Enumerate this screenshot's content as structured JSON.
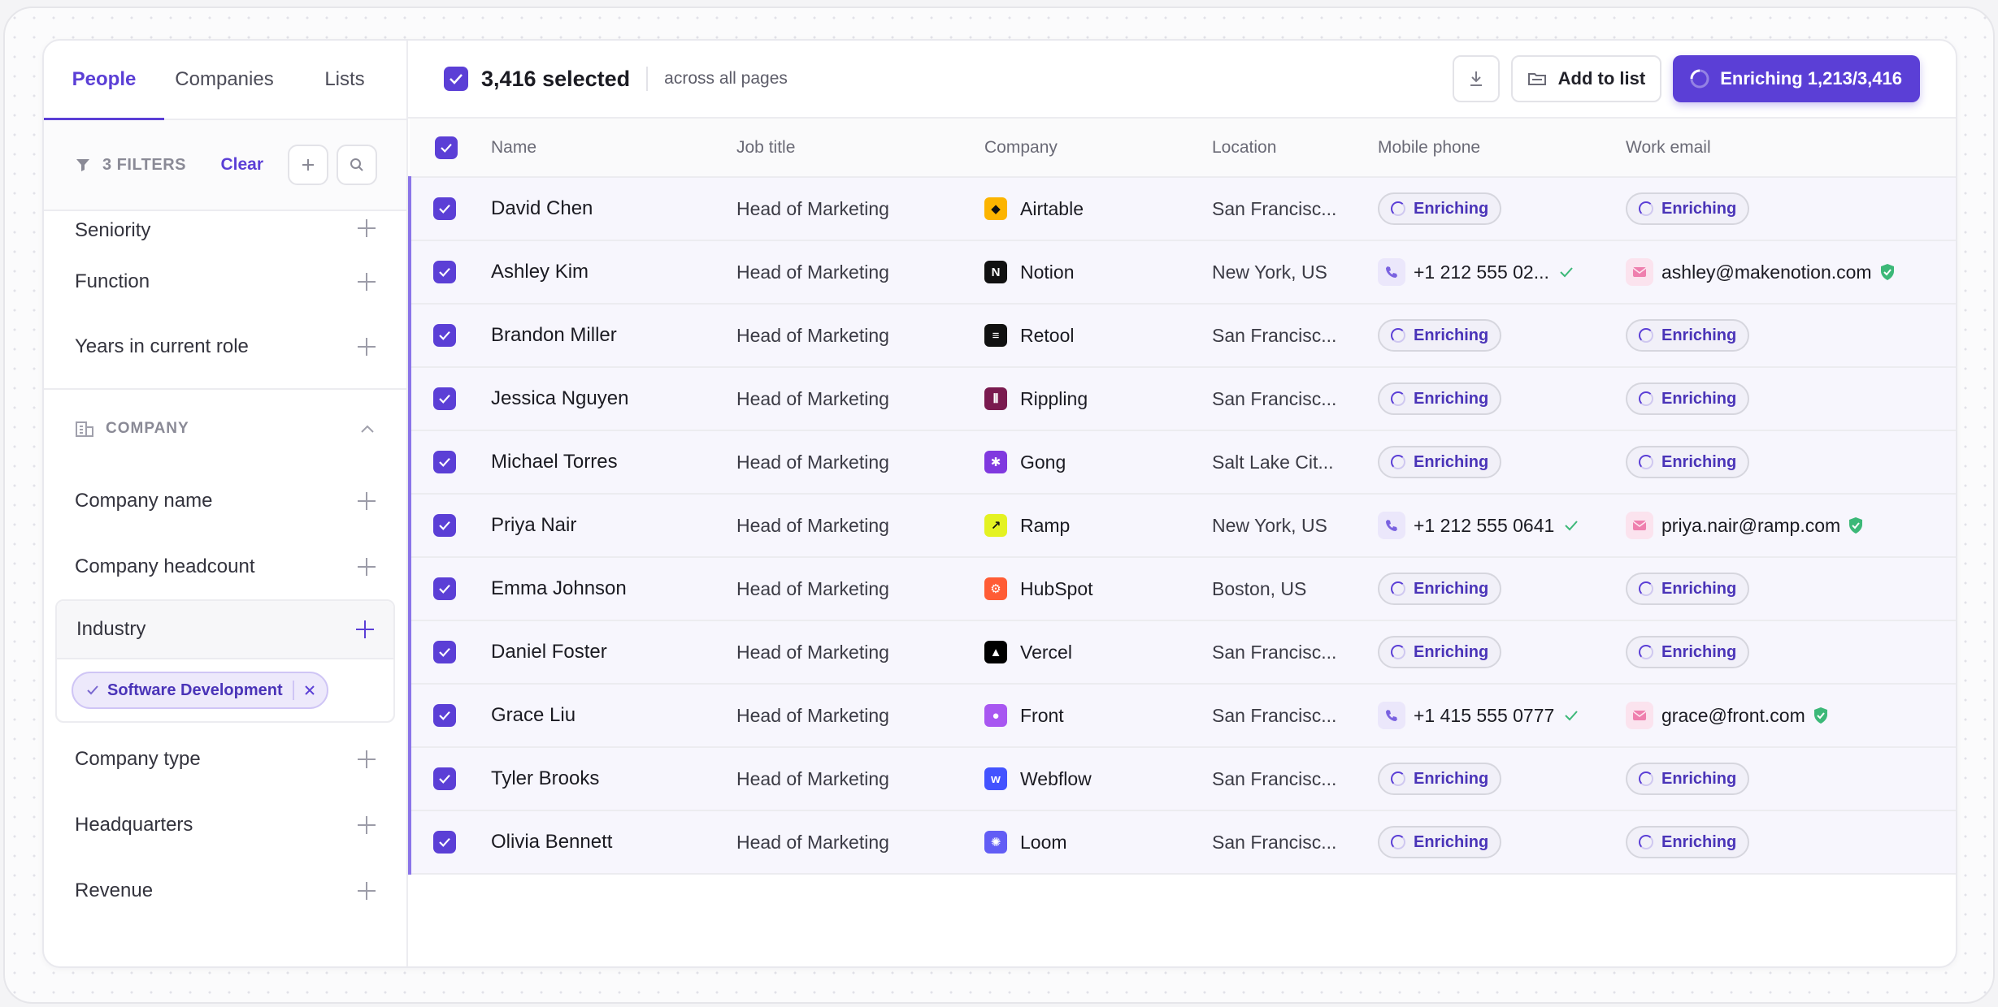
{
  "tabs": {
    "people": "People",
    "companies": "Companies",
    "lists": "Lists"
  },
  "filters": {
    "count_label": "3 FILTERS",
    "clear_label": "Clear",
    "person_items": [
      "Seniority",
      "Function",
      "Years in current role"
    ],
    "company_section": "COMPANY",
    "company_items_a": [
      "Company name",
      "Company headcount"
    ],
    "industry": {
      "label": "Industry",
      "chip": "Software Development"
    },
    "company_items_b": [
      "Company type",
      "Headquarters",
      "Revenue"
    ]
  },
  "topbar": {
    "selected": "3,416 selected",
    "across": "across all pages",
    "add_to_list": "Add to list",
    "enriching": "Enriching 1,213/3,416"
  },
  "table": {
    "headers": [
      "Name",
      "Job title",
      "Company",
      "Location",
      "Mobile phone",
      "Work email"
    ],
    "enriching_label": "Enriching",
    "rows": [
      {
        "name": "David Chen",
        "title": "Head of Marketing",
        "company": "Airtable",
        "logo": "airtable",
        "location": "San Francisc...",
        "phone": null,
        "email": null
      },
      {
        "name": "Ashley Kim",
        "title": "Head of Marketing",
        "company": "Notion",
        "logo": "notion",
        "location": "New York, US",
        "phone": "+1 212 555 02...",
        "email": "ashley@makenotion.com"
      },
      {
        "name": "Brandon Miller",
        "title": "Head of Marketing",
        "company": "Retool",
        "logo": "retool",
        "location": "San Francisc...",
        "phone": null,
        "email": null
      },
      {
        "name": "Jessica Nguyen",
        "title": "Head of Marketing",
        "company": "Rippling",
        "logo": "rippling",
        "location": "San Francisc...",
        "phone": null,
        "email": null
      },
      {
        "name": "Michael Torres",
        "title": "Head of Marketing",
        "company": "Gong",
        "logo": "gong",
        "location": "Salt Lake Cit...",
        "phone": null,
        "email": null
      },
      {
        "name": "Priya Nair",
        "title": "Head of Marketing",
        "company": "Ramp",
        "logo": "ramp",
        "location": "New York, US",
        "phone": "+1 212 555 0641",
        "email": "priya.nair@ramp.com"
      },
      {
        "name": "Emma Johnson",
        "title": "Head of Marketing",
        "company": "HubSpot",
        "logo": "hubspot",
        "location": "Boston, US",
        "phone": null,
        "email": null
      },
      {
        "name": "Daniel Foster",
        "title": "Head of Marketing",
        "company": "Vercel",
        "logo": "vercel",
        "location": "San Francisc...",
        "phone": null,
        "email": null
      },
      {
        "name": "Grace Liu",
        "title": "Head of Marketing",
        "company": "Front",
        "logo": "front",
        "location": "San Francisc...",
        "phone": "+1 415 555 0777",
        "email": "grace@front.com"
      },
      {
        "name": "Tyler Brooks",
        "title": "Head of Marketing",
        "company": "Webflow",
        "logo": "webflow",
        "location": "San Francisc...",
        "phone": null,
        "email": null
      },
      {
        "name": "Olivia Bennett",
        "title": "Head of Marketing",
        "company": "Loom",
        "logo": "loom",
        "location": "San Francisc...",
        "phone": null,
        "email": null
      }
    ]
  },
  "colors": {
    "accent": "#5b3fd6",
    "verified": "#3cb878",
    "logos": {
      "airtable": "#fcb400",
      "notion": "#111111",
      "retool": "#111111",
      "rippling": "#7a1a4f",
      "gong": "#8039df",
      "ramp": "#e4f222",
      "hubspot": "#ff5c35",
      "vercel": "#000000",
      "front": "#a857f1",
      "webflow": "#4353ff",
      "loom": "#625df5"
    }
  }
}
